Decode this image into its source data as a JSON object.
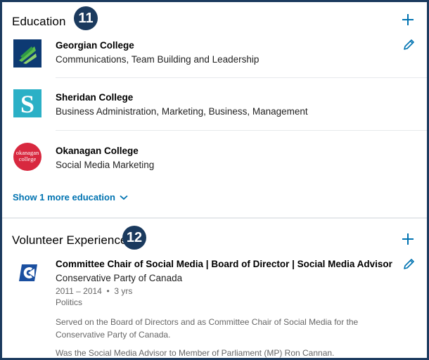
{
  "education": {
    "title": "Education",
    "badge": "11",
    "items": [
      {
        "school": "Georgian College",
        "fields": "Communications, Team Building and Leadership"
      },
      {
        "school": "Sheridan College",
        "fields": "Business Administration, Marketing, Business, Management"
      },
      {
        "school": "Okanagan College",
        "fields": "Social Media Marketing",
        "logo_text_1": "okanagan",
        "logo_text_2": "college"
      }
    ],
    "show_more_label": "Show 1 more education"
  },
  "volunteer": {
    "title": "Volunteer Experience",
    "badge": "12",
    "role": "Committee Chair of Social Media | Board of Director | Social Media Advisor",
    "organization": "Conservative Party of Canada",
    "dates": "2011 – 2014",
    "duration": "3 yrs",
    "cause": "Politics",
    "description_1": "Served on the Board of Directors and as Committee Chair of Social Media for the Conservative Party of Canada.",
    "description_2": "Was the Social Media Advisor to Member of Parliament (MP) Ron Cannan."
  },
  "colors": {
    "frame": "#1b3a5e",
    "link": "#0073b1",
    "sheridan": "#2bb0c6",
    "okanagan": "#d8283f"
  }
}
